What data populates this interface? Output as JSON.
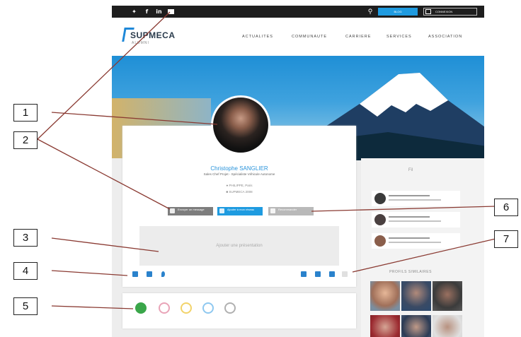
{
  "site": {
    "social_icons": [
      "twitter-icon",
      "facebook-icon",
      "linkedin-icon",
      "email-icon"
    ],
    "topbar": {
      "search_icon": "search-icon",
      "blue_button_label": "BLOG",
      "connect_label": "CONNEXION"
    },
    "logo": {
      "name": "SUPMECA",
      "tagline": "ALUMNI"
    },
    "nav": [
      "ACTUALITES",
      "COMMUNAUTE",
      "CARRIERE",
      "SERVICES",
      "ASSOCIATION"
    ],
    "profile": {
      "name": "Christophe SANGLIER",
      "title": "Sales Chef Projet - Spécialiste Véhicule Autonome",
      "location": "PHILIPPE, Paris",
      "promo": "SUPMECA 2008",
      "actions": [
        {
          "label": "Envoyer un message",
          "color": "#7d7d7d"
        },
        {
          "label": "Ajouter à mon réseau",
          "color": "#1e9be0"
        },
        {
          "label": "Recommander",
          "color": "#b9b9b9"
        }
      ],
      "presentation_placeholder": "Ajouter une présentation",
      "contact_icons_left": [
        "email-icon",
        "phone-icon",
        "location-pin-icon"
      ],
      "contact_icons_right": [
        "facebook-icon",
        "twitter-icon",
        "linkedin-icon",
        "more-icon"
      ]
    },
    "badges": [
      {
        "color": "#3aa64a"
      },
      {
        "color": "#e9a4b8"
      },
      {
        "color": "#f2d36a"
      },
      {
        "color": "#8ec8f0"
      },
      {
        "color": "#b0b0b0"
      }
    ],
    "sidebar": {
      "feed_title": "Fil",
      "profiles_title": "PROFILS SIMILAIRES"
    }
  },
  "annotations": [
    "1",
    "2",
    "3",
    "4",
    "5",
    "6",
    "7"
  ]
}
